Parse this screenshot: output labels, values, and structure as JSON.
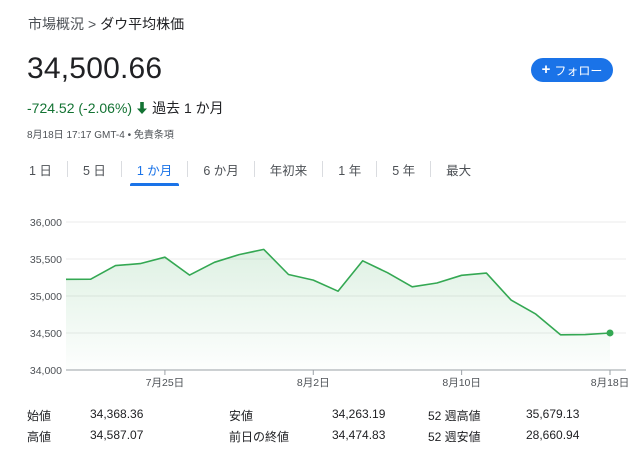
{
  "breadcrumb": {
    "parent": "市場概況",
    "separator": ">",
    "current": "ダウ平均株価"
  },
  "quote": {
    "price": "34,500.66",
    "change": "-724.52 (-2.06%)",
    "period": "過去 1 か月",
    "timestamp": "8月18日 17:17 GMT-4 • 免責条項"
  },
  "follow_button": {
    "label": "フォロー",
    "icon": "plus-icon"
  },
  "tabs": [
    {
      "label": "1 日",
      "active": false
    },
    {
      "label": "5 日",
      "active": false
    },
    {
      "label": "1 か月",
      "active": true
    },
    {
      "label": "6 か月",
      "active": false
    },
    {
      "label": "年初来",
      "active": false
    },
    {
      "label": "1 年",
      "active": false
    },
    {
      "label": "5 年",
      "active": false
    },
    {
      "label": "最大",
      "active": false
    }
  ],
  "colors": {
    "accent": "#1a73e8",
    "positive_line": "#34a853",
    "change_text": "#137333"
  },
  "chart_data": {
    "type": "area",
    "x": [
      "7月19日",
      "7月20日",
      "7月21日",
      "7月24日",
      "7月25日",
      "7月26日",
      "7月27日",
      "7月28日",
      "7月31日",
      "8月1日",
      "8月2日",
      "8月3日",
      "8月4日",
      "8月7日",
      "8月8日",
      "8月9日",
      "8月10日",
      "8月11日",
      "8月14日",
      "8月15日",
      "8月16日",
      "8月17日",
      "8月18日"
    ],
    "values": [
      35225,
      35227,
      35411,
      35438,
      35525,
      35283,
      35455,
      35560,
      35630,
      35290,
      35215,
      35065,
      35475,
      35315,
      35125,
      35175,
      35280,
      35310,
      34945,
      34755,
      34475,
      34478,
      34500.66
    ],
    "x_tick_labels": [
      "7月25日",
      "8月2日",
      "8月10日",
      "8月18日"
    ],
    "y_tick_labels": [
      "36,000",
      "35,500",
      "35,000",
      "34,500",
      "34,000"
    ],
    "ylim": [
      34000,
      36000
    ],
    "grid": true
  },
  "stats": [
    {
      "label": "始値",
      "value": "34,368.36"
    },
    {
      "label": "安値",
      "value": "34,263.19"
    },
    {
      "label": "52 週高値",
      "value": "35,679.13"
    },
    {
      "label": "高値",
      "value": "34,587.07"
    },
    {
      "label": "前日の終値",
      "value": "34,474.83"
    },
    {
      "label": "52 週安値",
      "value": "28,660.94"
    }
  ]
}
